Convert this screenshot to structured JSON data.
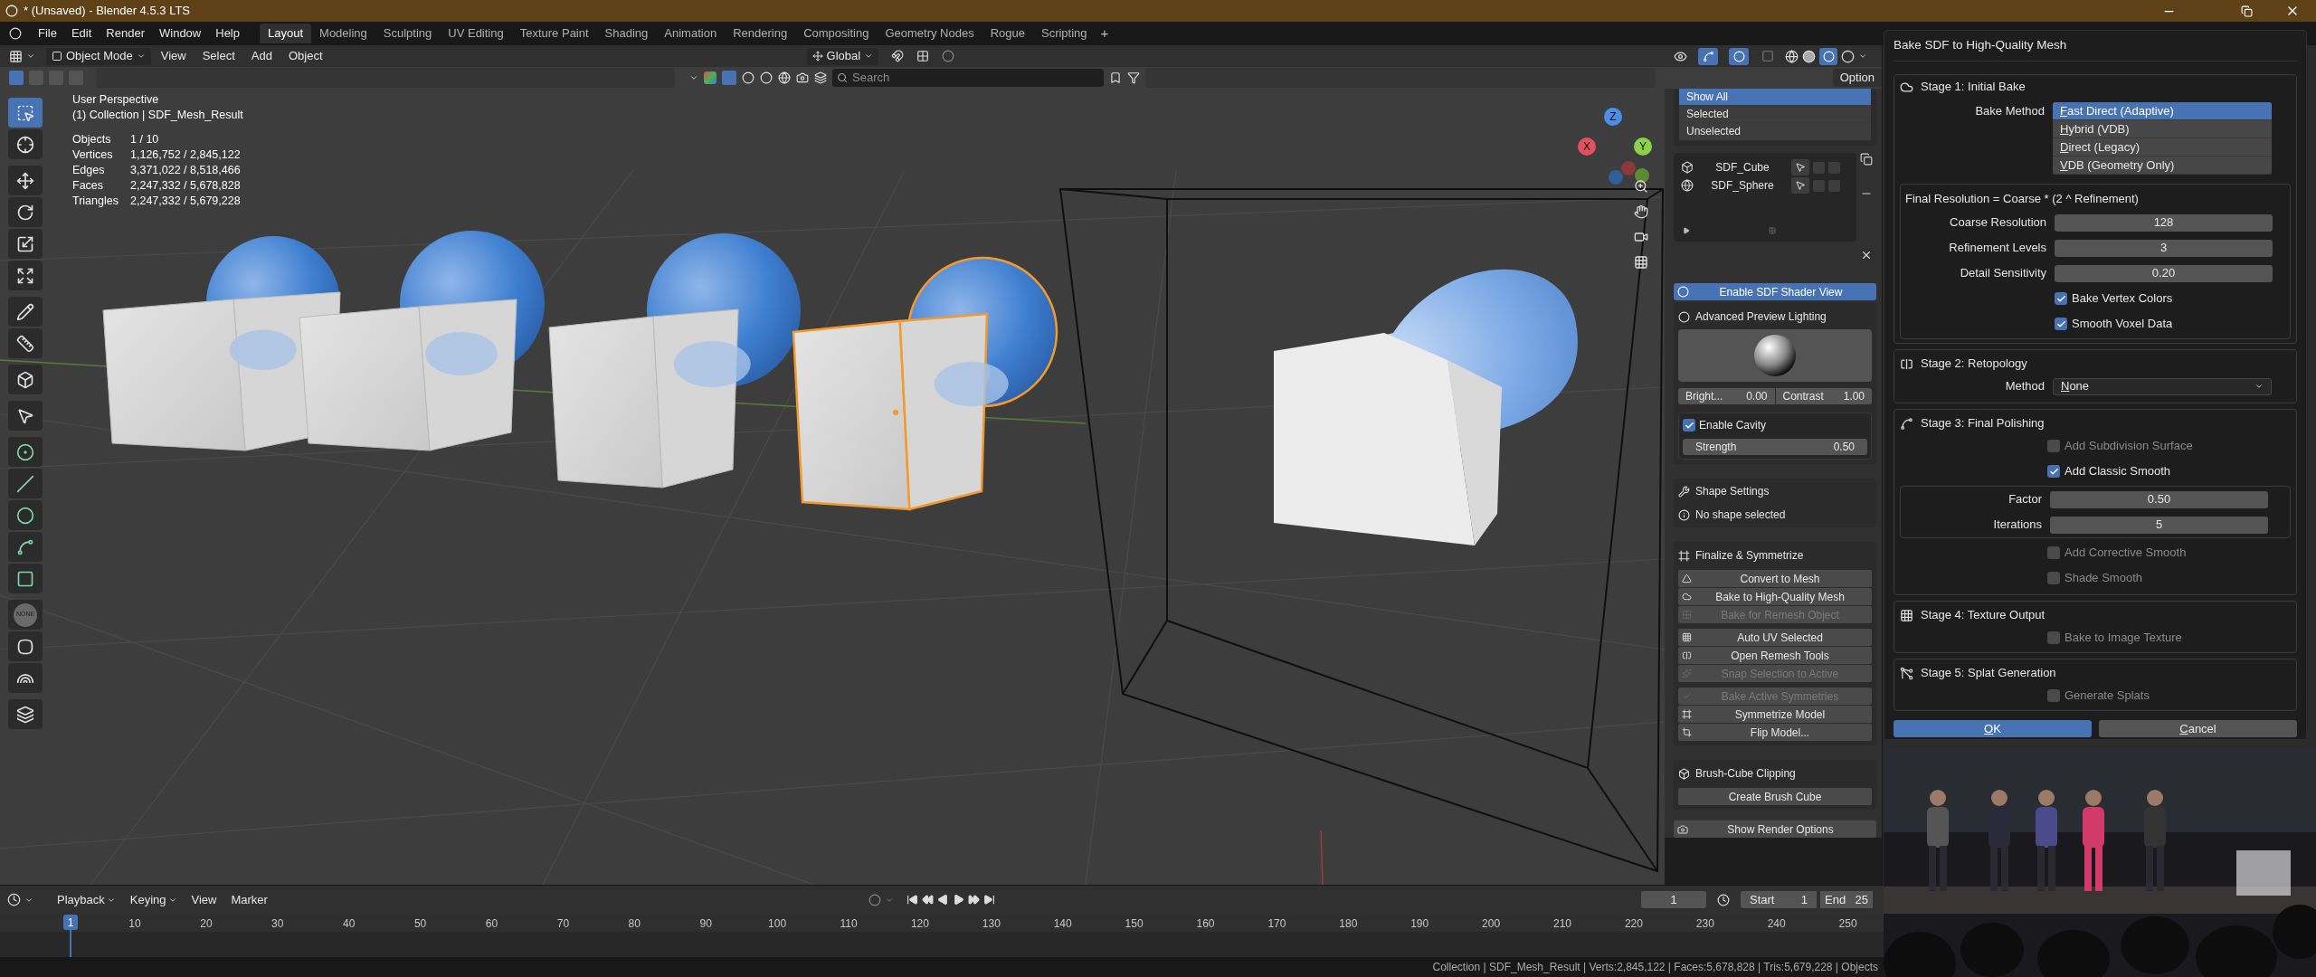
{
  "title_bar": {
    "title": "* (Unsaved) - Blender 4.5.3 LTS"
  },
  "menu": [
    "File",
    "Edit",
    "Render",
    "Window",
    "Help"
  ],
  "workspaces": [
    {
      "label": "Layout",
      "selected": true
    },
    {
      "label": "Modeling",
      "selected": false
    },
    {
      "label": "Sculpting",
      "selected": false
    },
    {
      "label": "UV Editing",
      "selected": false
    },
    {
      "label": "Texture Paint",
      "selected": false
    },
    {
      "label": "Shading",
      "selected": false
    },
    {
      "label": "Animation",
      "selected": false
    },
    {
      "label": "Rendering",
      "selected": false
    },
    {
      "label": "Compositing",
      "selected": false
    },
    {
      "label": "Geometry Nodes",
      "selected": false
    },
    {
      "label": "Rogue",
      "selected": false
    },
    {
      "label": "Scripting",
      "selected": false
    }
  ],
  "add_workspace": "+",
  "header": {
    "mode": "Object Mode",
    "menus": [
      "View",
      "Select",
      "Add",
      "Object"
    ],
    "orientation": "Global",
    "search_placeholder": "Search",
    "options": "Option"
  },
  "tools": [
    {
      "selected": true
    },
    {
      "selected": false
    },
    {
      "selected": false
    },
    {
      "selected": false
    },
    {
      "selected": false
    },
    {
      "selected": false
    },
    {
      "selected": false
    },
    {
      "selected": false
    },
    {
      "selected": false
    },
    {
      "selected": false
    },
    {
      "selected": false
    },
    {
      "selected": false
    },
    {
      "selected": false
    },
    {
      "selected": false
    },
    {
      "selected": false
    },
    {
      "selected": false,
      "label": "NONE"
    },
    {
      "selected": false
    },
    {
      "selected": false
    },
    {
      "selected": false
    }
  ],
  "viewport": {
    "view": "User Perspective",
    "collection": "(1) Collection | SDF_Mesh_Result",
    "stats": [
      {
        "label": "Objects",
        "value": "1 / 10"
      },
      {
        "label": "Vertices",
        "value": "1,126,752 / 2,845,122"
      },
      {
        "label": "Edges",
        "value": "3,371,022 / 8,518,466"
      },
      {
        "label": "Faces",
        "value": "2,247,332 / 5,678,828"
      },
      {
        "label": "Triangles",
        "value": "2,247,332 / 5,679,228"
      }
    ],
    "gizmo": {
      "x": "X",
      "y": "Y",
      "z": "Z"
    }
  },
  "sidebar": {
    "filter": [
      {
        "label": "Show All",
        "selected": true
      },
      {
        "label": "Selected",
        "selected": false
      },
      {
        "label": "Unselected",
        "selected": false
      }
    ],
    "shapes": [
      {
        "name": "SDF_Cube",
        "kind": "cube"
      },
      {
        "name": "SDF_Sphere",
        "kind": "sphere"
      }
    ],
    "shader_button": "Enable SDF Shader View",
    "lighting": {
      "title": "Advanced Preview Lighting",
      "brightness_label": "Bright...",
      "brightness": "0.00",
      "contrast_label": "Contrast",
      "contrast": "1.00",
      "cavity": {
        "label": "Enable Cavity",
        "checked": true
      },
      "strength_label": "Strength",
      "strength": "0.50"
    },
    "shape_settings": {
      "title": "Shape Settings",
      "message": "No shape selected"
    },
    "finalize": {
      "title": "Finalize & Symmetrize",
      "groups": [
        [
          {
            "label": "Convert to Mesh",
            "disabled": false
          },
          {
            "label": "Bake to High-Quality Mesh",
            "disabled": false
          },
          {
            "label": "Bake for Remesh Object",
            "disabled": true
          }
        ],
        [
          {
            "label": "Auto UV Selected",
            "disabled": false
          },
          {
            "label": "Open Remesh Tools",
            "disabled": false
          },
          {
            "label": "Snap Selection to Active",
            "disabled": true
          }
        ],
        [
          {
            "label": "Bake Active Symmetries",
            "disabled": true
          },
          {
            "label": "Symmetrize Model",
            "disabled": false
          },
          {
            "label": "Flip Model...",
            "disabled": false
          }
        ]
      ]
    },
    "clipping": {
      "title": "Brush-Cube Clipping",
      "button": "Create Brush Cube"
    },
    "render_options": "Show Render Options"
  },
  "dialog": {
    "title": "Bake SDF to High-Quality Mesh",
    "stage1": {
      "title": "Stage 1: Initial Bake",
      "method_label": "Bake Method",
      "methods": [
        {
          "label": "Fast Direct (Adaptive)",
          "selected": true,
          "mnemonic": true
        },
        {
          "label": "Hybrid (VDB)",
          "selected": false,
          "mnemonic": true
        },
        {
          "label": "Direct (Legacy)",
          "selected": false,
          "mnemonic": true
        },
        {
          "label": "VDB (Geometry Only)",
          "selected": false,
          "mnemonic": true
        }
      ],
      "formula": "Final Resolution = Coarse * (2 ^ Refinement)",
      "fields": [
        {
          "label": "Coarse Resolution",
          "value": "128"
        },
        {
          "label": "Refinement Levels",
          "value": "3"
        },
        {
          "label": "Detail Sensitivity",
          "value": "0.20"
        }
      ],
      "options": [
        {
          "label": "Bake Vertex Colors",
          "checked": true
        },
        {
          "label": "Smooth Voxel Data",
          "checked": true
        }
      ]
    },
    "stage2": {
      "title": "Stage 2: Retopology",
      "method_label": "Method",
      "method": "None",
      "mnemonic": true
    },
    "stage3": {
      "title": "Stage 3: Final Polishing",
      "options_before": [
        {
          "label": "Add Subdivision Surface",
          "checked": false
        },
        {
          "label": "Add Classic Smooth",
          "checked": true
        }
      ],
      "fields": [
        {
          "label": "Factor",
          "value": "0.50"
        },
        {
          "label": "Iterations",
          "value": "5"
        }
      ],
      "options_after": [
        {
          "label": "Add Corrective Smooth",
          "checked": false
        },
        {
          "label": "Shade Smooth",
          "checked": false
        }
      ]
    },
    "stage4": {
      "title": "Stage 4: Texture Output",
      "options": [
        {
          "label": "Bake to Image Texture",
          "checked": false
        }
      ]
    },
    "stage5": {
      "title": "Stage 5: Splat Generation",
      "options": [
        {
          "label": "Generate Splats",
          "checked": false
        }
      ]
    },
    "ok": "OK",
    "cancel": "Cancel"
  },
  "timeline": {
    "menus": [
      {
        "label": "Playback",
        "dropdown": true
      },
      {
        "label": "Keying",
        "dropdown": true
      },
      {
        "label": "View",
        "dropdown": false
      },
      {
        "label": "Marker",
        "dropdown": false
      }
    ],
    "current_frame": "1",
    "start_label": "Start",
    "start": "1",
    "end_label": "End",
    "end": "25",
    "playhead": "1",
    "ruler": [
      "10",
      "20",
      "30",
      "40",
      "50",
      "60",
      "70",
      "80",
      "90",
      "100",
      "110",
      "120",
      "130",
      "140",
      "150",
      "160",
      "170",
      "180",
      "190",
      "200",
      "210",
      "220",
      "230",
      "240",
      "250"
    ]
  },
  "status_bar": "Collection | SDF_Mesh_Result | Verts:2,845,122 | Faces:5,678,828 | Tris:5,679,228 | Objects"
}
